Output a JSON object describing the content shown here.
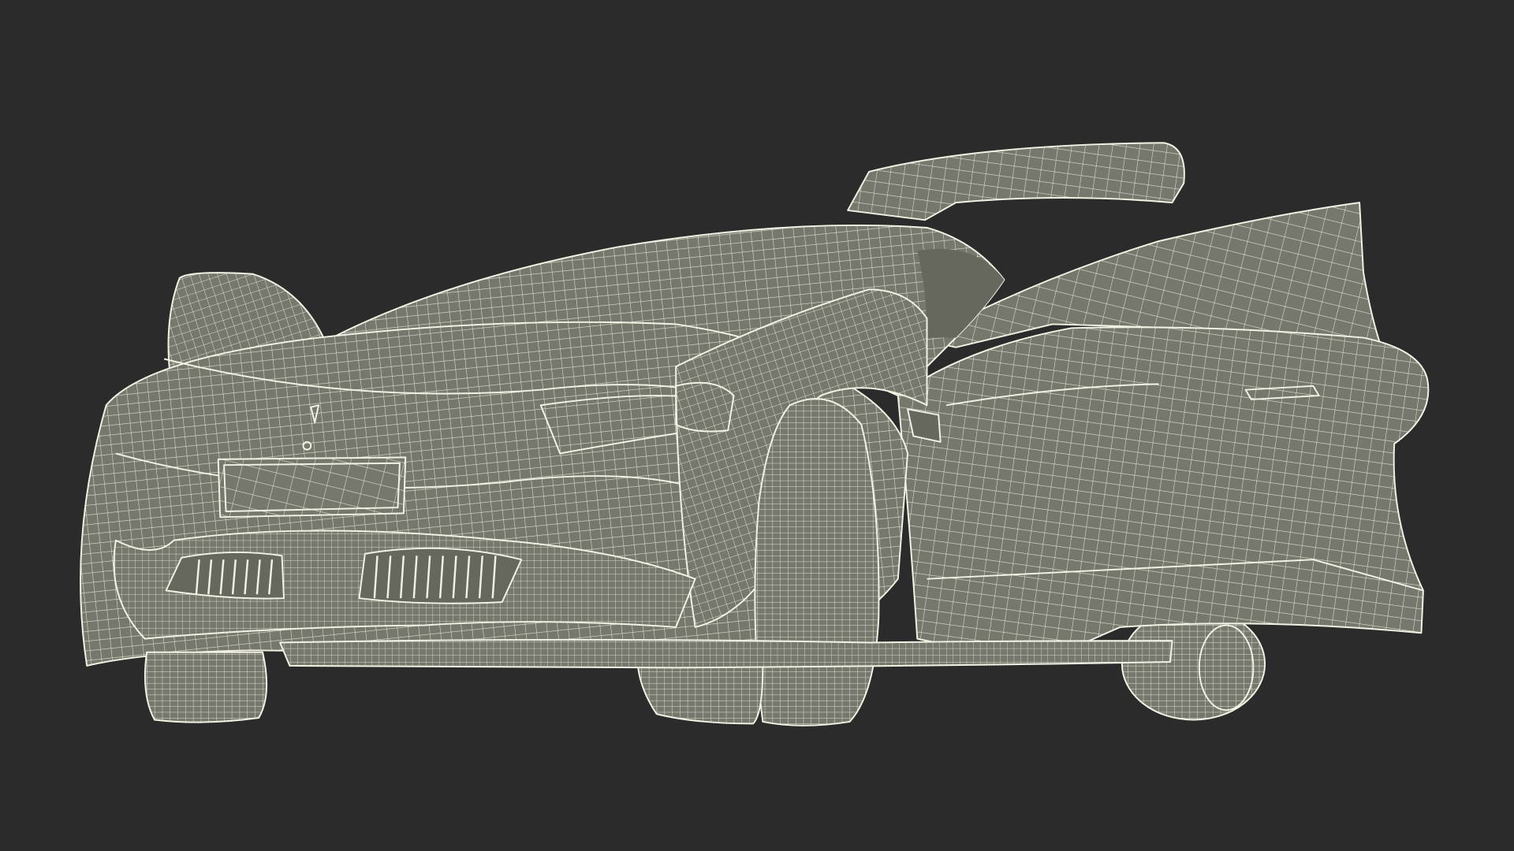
{
  "scene": {
    "background_color": "#2b2b2b",
    "model_fill_color": "#77786d",
    "model_shade_color": "#66675d",
    "wire_color": "#f2f2e4",
    "subject": "sports-car-wireframe"
  }
}
